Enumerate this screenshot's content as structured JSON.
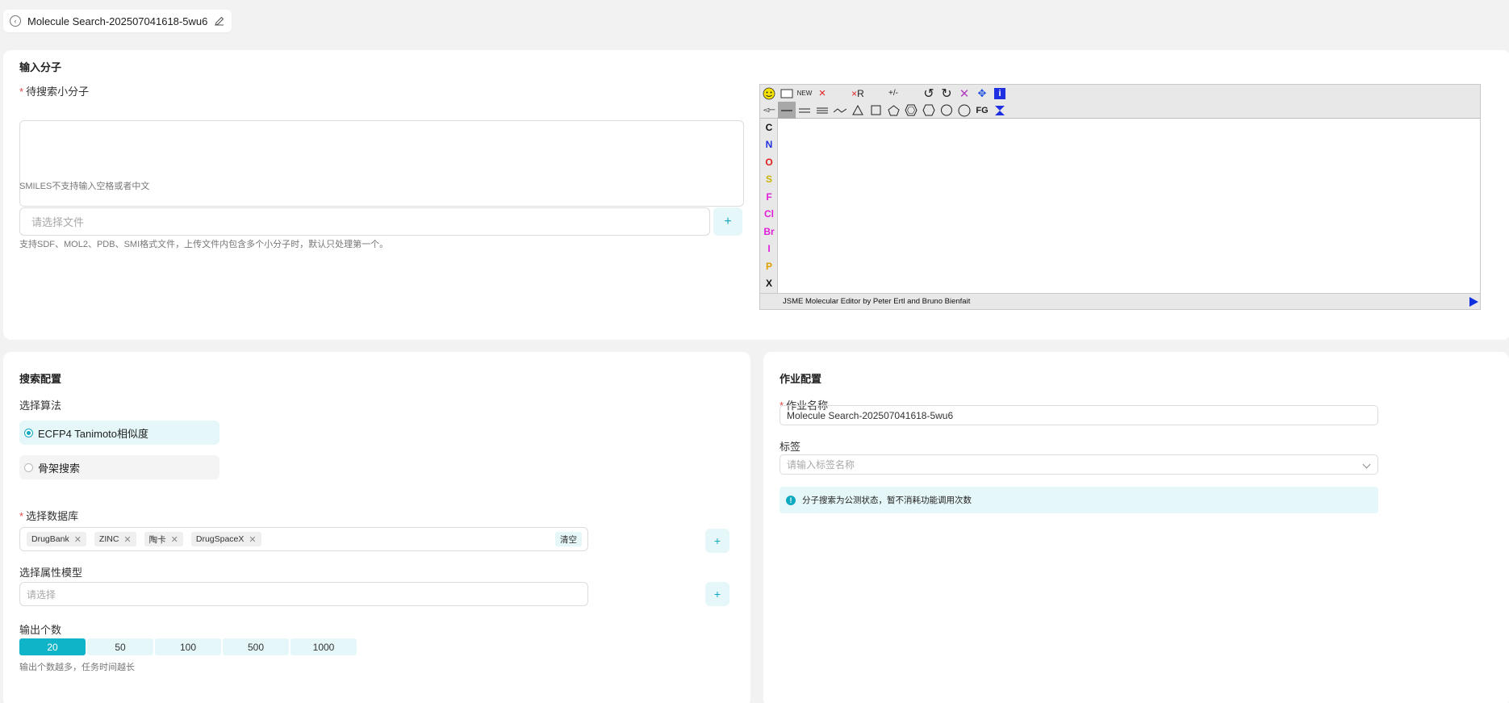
{
  "header": {
    "title": "Molecule Search-202507041618-5wu6",
    "back_icon": "back-circle-icon",
    "edit_icon": "pencil-icon"
  },
  "input_section": {
    "title": "输入分子",
    "molecule_label": "待搜索小分子",
    "smiles_hint": "SMILES不支持输入空格或者中文",
    "file_placeholder": "请选择文件",
    "file_hint": "支持SDF、MOL2、PDB、SMI格式文件，上传文件内包含多个小分子时，默认只处理第一个。",
    "plus": "+"
  },
  "jsme": {
    "footer": "JSME Molecular Editor by Peter Ertl and Bruno Bienfait",
    "toolbar_row1": [
      "smiley",
      "rect",
      "NEW",
      "×",
      "",
      "×R",
      "",
      "+/-",
      "",
      "undo",
      "redo",
      "delete",
      "move",
      "i"
    ],
    "toolbar_row2": [
      "stereo",
      "single-bond",
      "double-bond",
      "triple-bond",
      "chain",
      "triangle",
      "square",
      "pentagon",
      "benzene",
      "hexagon",
      "heptagon",
      "octagon",
      "FG",
      "flip"
    ],
    "atoms": [
      {
        "symbol": "C",
        "color": "#111111"
      },
      {
        "symbol": "N",
        "color": "#1f30e0"
      },
      {
        "symbol": "O",
        "color": "#e01f1f"
      },
      {
        "symbol": "S",
        "color": "#c8b400"
      },
      {
        "symbol": "F",
        "color": "#e01fd8"
      },
      {
        "symbol": "Cl",
        "color": "#e01fd8"
      },
      {
        "symbol": "Br",
        "color": "#e01fd8"
      },
      {
        "symbol": "I",
        "color": "#e01fd8"
      },
      {
        "symbol": "P",
        "color": "#e0a000"
      },
      {
        "symbol": "X",
        "color": "#111111"
      }
    ]
  },
  "search_config": {
    "title": "搜索配置",
    "algorithm_label": "选择算法",
    "algorithms": [
      "ECFP4 Tanimoto相似度",
      "骨架搜索"
    ],
    "selected_algorithm": 0,
    "database_label": "选择数据库",
    "databases": [
      "DrugBank",
      "ZINC",
      "陶卡",
      "DrugSpaceX"
    ],
    "clear_label": "清空",
    "model_label": "选择属性模型",
    "model_placeholder": "请选择",
    "output_label": "输出个数",
    "output_options": [
      "20",
      "50",
      "100",
      "500",
      "1000"
    ],
    "output_selected": 0,
    "output_hint": "输出个数越多，任务时间越长"
  },
  "job_config": {
    "title": "作业配置",
    "name_label": "作业名称",
    "name_value": "Molecule Search-202507041618-5wu6",
    "tag_label": "标签",
    "tag_placeholder": "请输入标签名称",
    "notice": "分子搜索为公测状态，暂不消耗功能调用次数"
  },
  "colors": {
    "accent": "#10b4c9",
    "accent_light": "#e6f7f9",
    "required": "#e54545"
  }
}
